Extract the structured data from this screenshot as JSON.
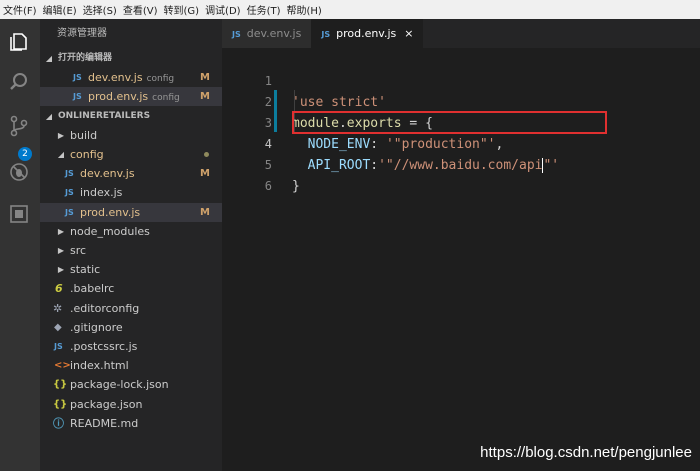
{
  "menu": [
    "文件(F)",
    "编辑(E)",
    "选择(S)",
    "查看(V)",
    "转到(G)",
    "调试(D)",
    "任务(T)",
    "帮助(H)"
  ],
  "activity": {
    "scm_badge": "2"
  },
  "sidebar": {
    "title": "资源管理器",
    "open_editors_header": "打开的编辑器",
    "open_editors": [
      {
        "icon": "JS",
        "name": "dev.env.js",
        "folder": "config",
        "status": "M"
      },
      {
        "icon": "JS",
        "name": "prod.env.js",
        "folder": "config",
        "status": "M"
      }
    ],
    "project_header": "ONLINERETAILERS",
    "tree": [
      {
        "name": "build",
        "type": "folder"
      },
      {
        "name": "config",
        "type": "folder-open"
      },
      {
        "name": "dev.env.js",
        "type": "js",
        "status": "M"
      },
      {
        "name": "index.js",
        "type": "js",
        "status": ""
      },
      {
        "name": "prod.env.js",
        "type": "js",
        "status": "M"
      },
      {
        "name": "node_modules",
        "type": "folder"
      },
      {
        "name": "src",
        "type": "folder"
      },
      {
        "name": "static",
        "type": "folder"
      },
      {
        "name": ".babelrc",
        "type": "babel"
      },
      {
        "name": ".editorconfig",
        "type": "gear"
      },
      {
        "name": ".gitignore",
        "type": "git"
      },
      {
        "name": ".postcssrc.js",
        "type": "js"
      },
      {
        "name": "index.html",
        "type": "html"
      },
      {
        "name": "package-lock.json",
        "type": "json"
      },
      {
        "name": "package.json",
        "type": "json"
      },
      {
        "name": "README.md",
        "type": "info"
      }
    ]
  },
  "tabs": [
    {
      "icon": "JS",
      "label": "dev.env.js",
      "active": false
    },
    {
      "icon": "JS",
      "label": "prod.env.js",
      "active": true,
      "close": "×"
    }
  ],
  "editor": {
    "line_numbers": [
      "1",
      "2",
      "3",
      "4",
      "5",
      "6"
    ],
    "l1": "'use strict'",
    "l2_a": "module",
    "l2_b": ".",
    "l2_c": "exports",
    "l2_d": " = {",
    "l3_key": "NODE_ENV",
    "l3_colon": ": ",
    "l3_val": "'\"production\"'",
    "l3_comma": ",",
    "l4_key": "API_ROOT",
    "l4_colon": ":",
    "l4_val_a": "'\"//www.baidu.com/api",
    "l4_val_b": "\"'",
    "l5": "}"
  },
  "watermark": "https://blog.csdn.net/pengjunlee"
}
